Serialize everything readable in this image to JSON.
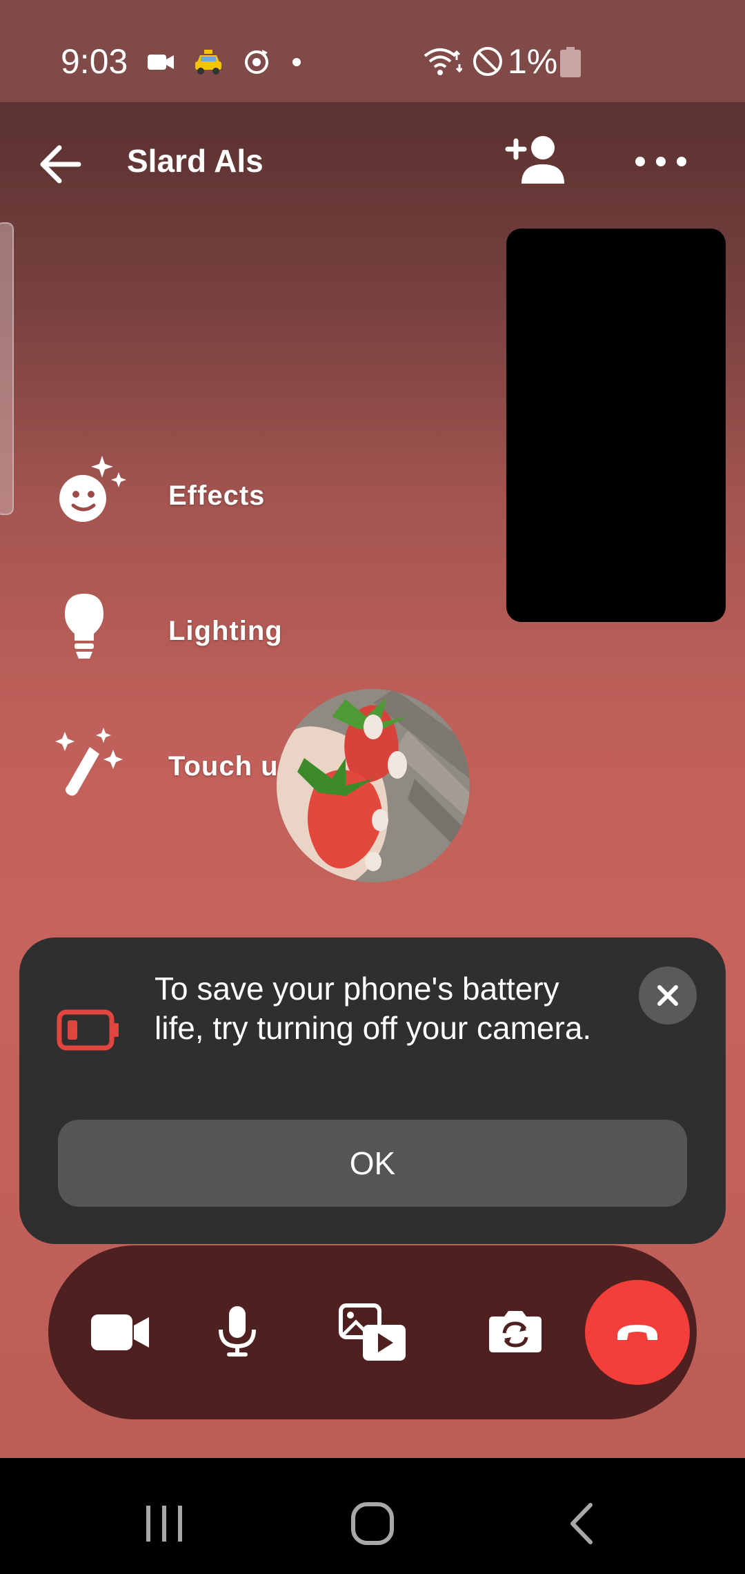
{
  "status_bar": {
    "time": "9:03",
    "battery_percent": "1%",
    "icons_left": [
      "video-camera-icon",
      "taxi-icon",
      "sync-icon",
      "dot-icon"
    ],
    "icons_right": [
      "wifi-icon",
      "do-not-disturb-icon",
      "battery-icon"
    ]
  },
  "header": {
    "title": "Slard Als"
  },
  "effects": [
    {
      "label": "Effects",
      "icon": "smiley-sparkle-icon"
    },
    {
      "label": "Lighting",
      "icon": "lightbulb-icon"
    },
    {
      "label": "Touch up",
      "icon": "magic-wand-icon"
    }
  ],
  "battery_banner": {
    "message": "To save your phone's battery life, try turning off your camera.",
    "ok_label": "OK"
  },
  "call_controls": [
    "video-icon",
    "microphone-icon",
    "media-share-icon",
    "flip-camera-icon",
    "end-call-icon"
  ],
  "colors": {
    "status_bar": "#7f4a47",
    "end_call": "#f43e3a",
    "banner": "#2f2f2f",
    "controls_bar": "#4f2020",
    "battery_warning": "#e2443f"
  }
}
